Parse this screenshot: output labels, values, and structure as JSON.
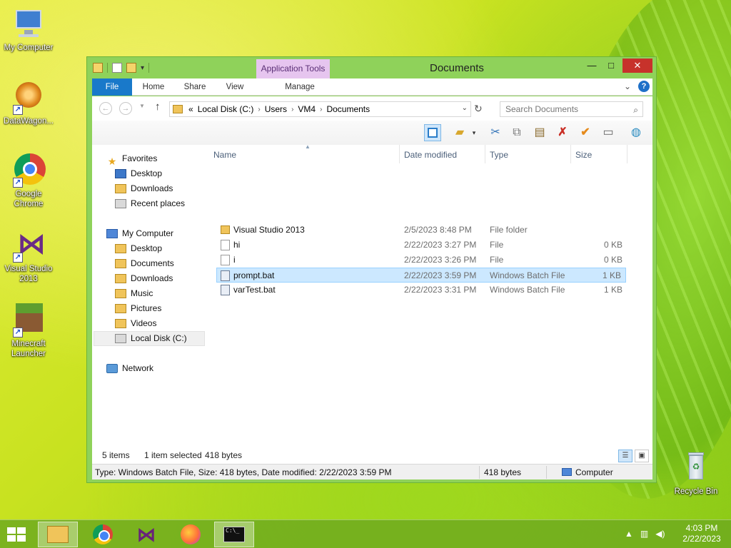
{
  "desktop": {
    "icons": [
      {
        "label": "My Computer"
      },
      {
        "label": "DataWagon..."
      },
      {
        "label": "Google Chrome"
      },
      {
        "label": "Visual Studio 2013"
      },
      {
        "label": "Minecraft Launcher"
      },
      {
        "label": "Recycle Bin"
      }
    ]
  },
  "window": {
    "title": "Documents",
    "contextual_tab": "Application Tools",
    "controls": {
      "minimize": "—",
      "maximize": "□",
      "close": "✕"
    },
    "ribbon_tabs": [
      "File",
      "Home",
      "Share",
      "View",
      "Manage"
    ],
    "ribbon_collapse": "⌄",
    "help": "?"
  },
  "address": {
    "back": "←",
    "forward": "→",
    "up": "↑",
    "overflow": "«",
    "crumbs": [
      "Local Disk (C:)",
      "Users",
      "VM4",
      "Documents"
    ],
    "separator": "›",
    "refresh": "↻",
    "search_placeholder": "Search Documents"
  },
  "toolbar": {
    "icons": [
      "layout-pane-icon",
      "folder-check-icon",
      "cut-icon",
      "copy-icon",
      "paste-icon",
      "delete-icon",
      "checkmark-icon",
      "properties-icon",
      "globe-icon"
    ]
  },
  "nav": {
    "favorites": {
      "label": "Favorites",
      "items": [
        "Desktop",
        "Downloads",
        "Recent places"
      ]
    },
    "computer": {
      "label": "My Computer",
      "items": [
        "Desktop",
        "Documents",
        "Downloads",
        "Music",
        "Pictures",
        "Videos",
        "Local Disk (C:)"
      ]
    },
    "network": {
      "label": "Network"
    },
    "selected": "Local Disk (C:)"
  },
  "files": {
    "columns": [
      "Name",
      "Date modified",
      "Type",
      "Size"
    ],
    "rows": [
      {
        "name": "Visual Studio 2013",
        "date": "2/5/2023 8:48 PM",
        "type": "File folder",
        "size": "",
        "kind": "folder"
      },
      {
        "name": "hi",
        "date": "2/22/2023 3:27 PM",
        "type": "File",
        "size": "0 KB",
        "kind": "file"
      },
      {
        "name": "i",
        "date": "2/22/2023 3:26 PM",
        "type": "File",
        "size": "0 KB",
        "kind": "file"
      },
      {
        "name": "prompt.bat",
        "date": "2/22/2023 3:59 PM",
        "type": "Windows Batch File",
        "size": "1 KB",
        "kind": "bat",
        "selected": true
      },
      {
        "name": "varTest.bat",
        "date": "2/22/2023 3:31 PM",
        "type": "Windows Batch File",
        "size": "1 KB",
        "kind": "bat"
      }
    ]
  },
  "info_bar": {
    "item_count": "5 items",
    "selection": "1 item selected",
    "selection_size": "418 bytes"
  },
  "status": {
    "details": "Type: Windows Batch File, Size: 418 bytes, Date modified: 2/22/2023 3:59 PM",
    "size": "418 bytes",
    "location": "Computer"
  },
  "taskbar": {
    "apps": [
      "File Explorer",
      "Google Chrome",
      "Visual Studio 2013",
      "Firefox",
      "Command Prompt"
    ],
    "time": "4:03 PM",
    "date": "2/22/2023"
  },
  "colors": {
    "file_tab": "#1979ca",
    "contextual_tab": "#e6c5ef",
    "close_button": "#c7322b",
    "selection": "#cce8ff"
  }
}
